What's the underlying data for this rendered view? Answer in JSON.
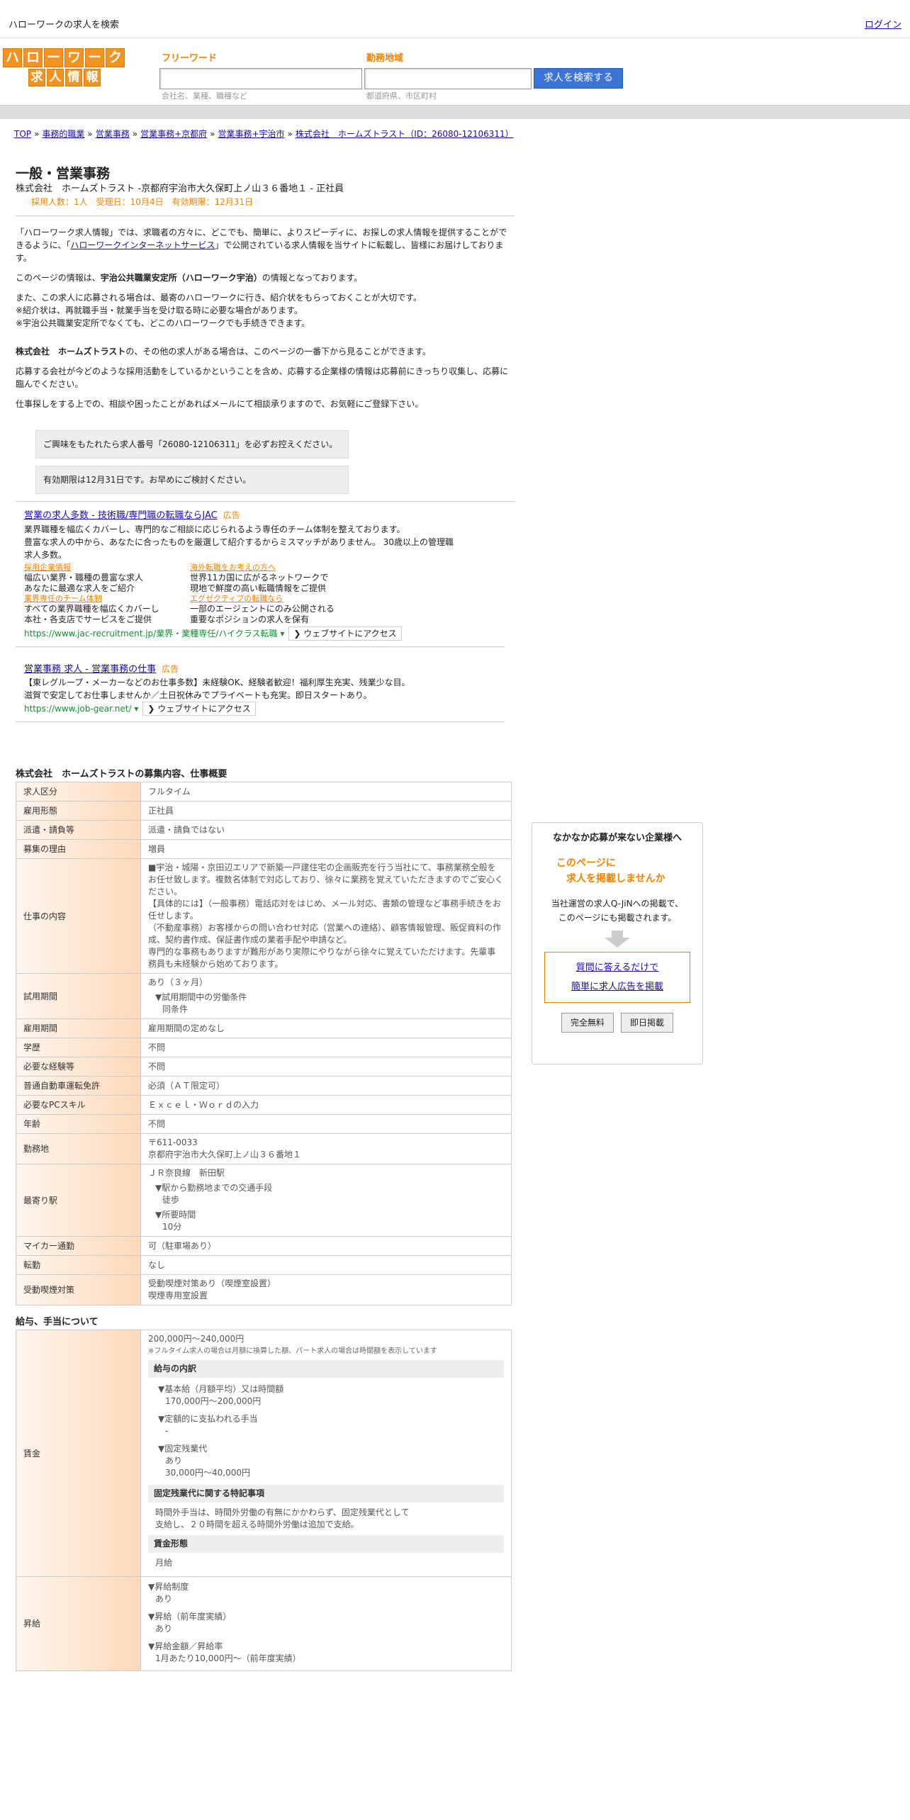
{
  "topbar": {
    "site_title": "ハローワークの求人を検索",
    "login": "ログイン"
  },
  "logo": {
    "row1": [
      "ハ",
      "ロ",
      "ー",
      "ワ",
      "ー",
      "ク"
    ],
    "row2": [
      "求",
      "人",
      "情",
      "報"
    ]
  },
  "search": {
    "keyword_label": "フリーワード",
    "keyword_hint": "会社名、業種、職種など",
    "area_label": "勤務地域",
    "area_hint": "都道府県、市区町村",
    "button": "求人を検索する"
  },
  "breadcrumb": [
    "TOP",
    "事務的職業",
    "営業事務",
    "営業事務+京都府",
    "営業事務+宇治市",
    "株式会社　ホームズトラスト（ID：26080-12106311）"
  ],
  "job": {
    "title": "一般・営業事務",
    "subtitle": "株式会社　ホームズトラスト -京都府宇治市大久保町上ノ山３６番地１ - 正社員",
    "meta": "採用人数：1人　受理日：10月4日　有効期限：12月31日"
  },
  "intro": {
    "p1a": "「ハローワーク求人情報」では、求職者の方々に、どこでも、簡単に、よりスピーディに、お探しの求人情報を提供することができるように、「",
    "p1link": "ハローワークインターネットサービス",
    "p1b": "」で公開されている求人情報を当サイトに転載し、皆様にお届けしております。",
    "p2a": "このページの情報は、",
    "p2bold": "宇治公共職業安定所（ハローワーク宇治）",
    "p2b": "の情報となっております。",
    "p3": "また、この求人に応募される場合は、最寄のハローワークに行き、紹介状をもらっておくことが大切です。",
    "p3b": "※紹介状は、再就職手当・就業手当を受け取る時に必要な場合があります。",
    "p3c": "※宇治公共職業安定所でなくても、どこのハローワークでも手続きできます。",
    "p4bold": "株式会社　ホームズトラスト",
    "p4": "の、その他の求人がある場合は、このページの一番下から見ることができます。",
    "p5": "応募する会社が今どのような採用活動をしているかということを含め、応募する企業様の情報は応募前にきっちり収集し、応募に臨んでください。",
    "p6": "仕事探しをする上での、相談や困ったことがあればメールにて相談承りますので、お気軽にご登録下さい。"
  },
  "notices": [
    "ご興味をもたれたら求人番号「26080-12106311」を必ずお控えください。",
    "有効期限は12月31日です。お早めにご検討ください。"
  ],
  "ads": {
    "ad1": {
      "title": "営業の求人多数 - 技術職/専門職の転職ならJAC",
      "tag": "広告",
      "desc1": "業界職種を幅広くカバーし、専門的なご相談に応じられるよう専任のチーム体制を整えております。",
      "desc2": "豊富な求人の中から、あなたに合ったものを厳選して紹介するからミスマッチがありません。 30歳以上の管理職求人多数。",
      "links": [
        {
          "label": "採用企業情報",
          "text": "幅広い業界・職種の豊富な求人\nあなたに最適な求人をご紹介"
        },
        {
          "label": "海外転職をお考えの方へ",
          "text": "世界11カ国に広がるネットワークで\n現地で鮮度の高い転職情報をご提供"
        },
        {
          "label": "業界専任のチーム体制",
          "text": "すべての業界職種を幅広くカバーし\n本社・各支店でサービスをご提供"
        },
        {
          "label": "エグゼクティブの転職なら",
          "text": "一部のエージェントにのみ公開される\n重要なポジションの求人を保有"
        }
      ],
      "url": "https://www.jac-recruitment.jp/業界・業種専任/ハイクラス転職",
      "button": "❯ ウェブサイトにアクセス"
    },
    "ad2": {
      "title": "営業事務 求人 - 営業事務の仕事",
      "tag": "広告",
      "desc1": "【東レグループ・メーカーなどのお仕事多数】未経験OK、経験者歓迎！福利厚生充実、残業少な目。",
      "desc2": "滋賀で安定してお仕事しませんか／土日祝休みでプライベートも充実。即日スタートあり。",
      "url": "https://www.job-gear.net/",
      "button": "❯ ウェブサイトにアクセス"
    }
  },
  "summary": {
    "heading": "株式会社　ホームズトラストの募集内容、仕事概要",
    "rows": [
      {
        "label": "求人区分",
        "value": "フルタイム"
      },
      {
        "label": "雇用形態",
        "value": "正社員"
      },
      {
        "label": "派遣・請負等",
        "value": "派遣・請負ではない"
      },
      {
        "label": "募集の理由",
        "value": "増員"
      },
      {
        "label": "仕事の内容",
        "value": "■宇治・城陽・京田辺エリアで新築一戸建住宅の企画販売を行う当社にて、事務業務全般をお任せ致します。複数名体制で対応しており、徐々に業務を覚えていただきますのでご安心ください。\n【具体的には】（一般事務）電話応対をはじめ、メール対応、書類の管理など事務手続きをお任せします。\n（不動産事務）お客様からの問い合わせ対応（営業への連絡）、顧客情報管理、販促資料の作成、契約書作成、保証書作成の業者手配や申請など。\n専門的な事務もありますが難形があり実際にやりながら徐々に覚えていただけます。先輩事務員も未経験から始めております。"
      },
      {
        "label": "試用期間",
        "value": "あり（３ヶ月）",
        "sub": [
          {
            "head": "▼試用期間中の労働条件",
            "body": "同条件"
          }
        ]
      },
      {
        "label": "雇用期間",
        "value": "雇用期間の定めなし"
      },
      {
        "label": "学歴",
        "value": "不問"
      },
      {
        "label": "必要な経験等",
        "value": "不問"
      },
      {
        "label": "普通自動車運転免許",
        "value": "必須（ＡＴ限定可）"
      },
      {
        "label": "必要なPCスキル",
        "value": "Ｅｘｃｅｌ・Ｗｏｒｄの入力"
      },
      {
        "label": "年齢",
        "value": "不問"
      },
      {
        "label": "勤務地",
        "value": "〒611-0033\n京都府宇治市大久保町上ノ山３６番地１"
      },
      {
        "label": "最寄り駅",
        "value": "ＪＲ奈良線　新田駅",
        "sub": [
          {
            "head": "▼駅から勤務地までの交通手段",
            "body": "徒歩"
          },
          {
            "head": "▼所要時間",
            "body": "10分"
          }
        ]
      },
      {
        "label": "マイカー通勤",
        "value": "可（駐車場あり）"
      },
      {
        "label": "転勤",
        "value": "なし"
      },
      {
        "label": "受動喫煙対策",
        "value": "受動喫煙対策あり（喫煙室設置）\n喫煙専用室設置"
      }
    ]
  },
  "salary": {
    "heading": "給与、手当について",
    "pay_label": "賃金",
    "pay_range": "200,000円〜240,000円",
    "pay_note": "※フルタイム求人の場合は月額に換算した額、パート求人の場合は時間額を表示しています",
    "breakdown_head": "給与の内訳",
    "breakdown": [
      {
        "head": "▼基本給（月額平均）又は時間額",
        "body": "170,000円〜200,000円"
      },
      {
        "head": "▼定額的に支払われる手当",
        "body": "-"
      },
      {
        "head": "▼固定残業代",
        "body": "あり\n30,000円〜40,000円"
      }
    ],
    "overtime_head": "固定残業代に関する特記事項",
    "overtime_text": "時間外手当は、時間外労働の有無にかかわらず、固定残業代として\n支給し、２０時間を超える時間外労働は追加で支給。",
    "form_head": "賃金形態",
    "form_value": "月給",
    "raise_label": "昇給",
    "raise": [
      {
        "head": "▼昇給制度",
        "body": "あり"
      },
      {
        "head": "▼昇給（前年度実績）",
        "body": "あり"
      },
      {
        "head": "▼昇給金額／昇給率",
        "body": "1月あたり10,000円〜（前年度実績）"
      }
    ]
  },
  "sidebox": {
    "title": "なかなか応募が来ない企業様へ",
    "line1": "このページに",
    "line2": "求人を掲載しませんか",
    "desc": "当社運営の求人Q-JiNへの掲載で、\nこのページにも掲載されます。",
    "link1": "質問に答えるだけで",
    "link2": "簡単に求人広告を掲載",
    "btn1": "完全無料",
    "btn2": "即日掲載"
  },
  "colors": {
    "accent": "#f08300",
    "link": "#1a0dab",
    "button": "#3b73d6"
  }
}
